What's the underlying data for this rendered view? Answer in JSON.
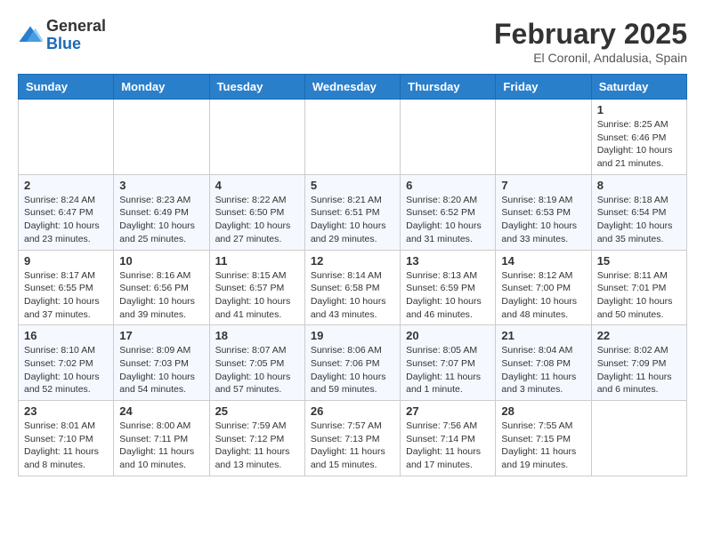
{
  "header": {
    "logo_general": "General",
    "logo_blue": "Blue",
    "month_title": "February 2025",
    "location": "El Coronil, Andalusia, Spain"
  },
  "weekdays": [
    "Sunday",
    "Monday",
    "Tuesday",
    "Wednesday",
    "Thursday",
    "Friday",
    "Saturday"
  ],
  "weeks": [
    [
      {
        "day": "",
        "info": ""
      },
      {
        "day": "",
        "info": ""
      },
      {
        "day": "",
        "info": ""
      },
      {
        "day": "",
        "info": ""
      },
      {
        "day": "",
        "info": ""
      },
      {
        "day": "",
        "info": ""
      },
      {
        "day": "1",
        "info": "Sunrise: 8:25 AM\nSunset: 6:46 PM\nDaylight: 10 hours and 21 minutes."
      }
    ],
    [
      {
        "day": "2",
        "info": "Sunrise: 8:24 AM\nSunset: 6:47 PM\nDaylight: 10 hours and 23 minutes."
      },
      {
        "day": "3",
        "info": "Sunrise: 8:23 AM\nSunset: 6:49 PM\nDaylight: 10 hours and 25 minutes."
      },
      {
        "day": "4",
        "info": "Sunrise: 8:22 AM\nSunset: 6:50 PM\nDaylight: 10 hours and 27 minutes."
      },
      {
        "day": "5",
        "info": "Sunrise: 8:21 AM\nSunset: 6:51 PM\nDaylight: 10 hours and 29 minutes."
      },
      {
        "day": "6",
        "info": "Sunrise: 8:20 AM\nSunset: 6:52 PM\nDaylight: 10 hours and 31 minutes."
      },
      {
        "day": "7",
        "info": "Sunrise: 8:19 AM\nSunset: 6:53 PM\nDaylight: 10 hours and 33 minutes."
      },
      {
        "day": "8",
        "info": "Sunrise: 8:18 AM\nSunset: 6:54 PM\nDaylight: 10 hours and 35 minutes."
      }
    ],
    [
      {
        "day": "9",
        "info": "Sunrise: 8:17 AM\nSunset: 6:55 PM\nDaylight: 10 hours and 37 minutes."
      },
      {
        "day": "10",
        "info": "Sunrise: 8:16 AM\nSunset: 6:56 PM\nDaylight: 10 hours and 39 minutes."
      },
      {
        "day": "11",
        "info": "Sunrise: 8:15 AM\nSunset: 6:57 PM\nDaylight: 10 hours and 41 minutes."
      },
      {
        "day": "12",
        "info": "Sunrise: 8:14 AM\nSunset: 6:58 PM\nDaylight: 10 hours and 43 minutes."
      },
      {
        "day": "13",
        "info": "Sunrise: 8:13 AM\nSunset: 6:59 PM\nDaylight: 10 hours and 46 minutes."
      },
      {
        "day": "14",
        "info": "Sunrise: 8:12 AM\nSunset: 7:00 PM\nDaylight: 10 hours and 48 minutes."
      },
      {
        "day": "15",
        "info": "Sunrise: 8:11 AM\nSunset: 7:01 PM\nDaylight: 10 hours and 50 minutes."
      }
    ],
    [
      {
        "day": "16",
        "info": "Sunrise: 8:10 AM\nSunset: 7:02 PM\nDaylight: 10 hours and 52 minutes."
      },
      {
        "day": "17",
        "info": "Sunrise: 8:09 AM\nSunset: 7:03 PM\nDaylight: 10 hours and 54 minutes."
      },
      {
        "day": "18",
        "info": "Sunrise: 8:07 AM\nSunset: 7:05 PM\nDaylight: 10 hours and 57 minutes."
      },
      {
        "day": "19",
        "info": "Sunrise: 8:06 AM\nSunset: 7:06 PM\nDaylight: 10 hours and 59 minutes."
      },
      {
        "day": "20",
        "info": "Sunrise: 8:05 AM\nSunset: 7:07 PM\nDaylight: 11 hours and 1 minute."
      },
      {
        "day": "21",
        "info": "Sunrise: 8:04 AM\nSunset: 7:08 PM\nDaylight: 11 hours and 3 minutes."
      },
      {
        "day": "22",
        "info": "Sunrise: 8:02 AM\nSunset: 7:09 PM\nDaylight: 11 hours and 6 minutes."
      }
    ],
    [
      {
        "day": "23",
        "info": "Sunrise: 8:01 AM\nSunset: 7:10 PM\nDaylight: 11 hours and 8 minutes."
      },
      {
        "day": "24",
        "info": "Sunrise: 8:00 AM\nSunset: 7:11 PM\nDaylight: 11 hours and 10 minutes."
      },
      {
        "day": "25",
        "info": "Sunrise: 7:59 AM\nSunset: 7:12 PM\nDaylight: 11 hours and 13 minutes."
      },
      {
        "day": "26",
        "info": "Sunrise: 7:57 AM\nSunset: 7:13 PM\nDaylight: 11 hours and 15 minutes."
      },
      {
        "day": "27",
        "info": "Sunrise: 7:56 AM\nSunset: 7:14 PM\nDaylight: 11 hours and 17 minutes."
      },
      {
        "day": "28",
        "info": "Sunrise: 7:55 AM\nSunset: 7:15 PM\nDaylight: 11 hours and 19 minutes."
      },
      {
        "day": "",
        "info": ""
      }
    ]
  ]
}
